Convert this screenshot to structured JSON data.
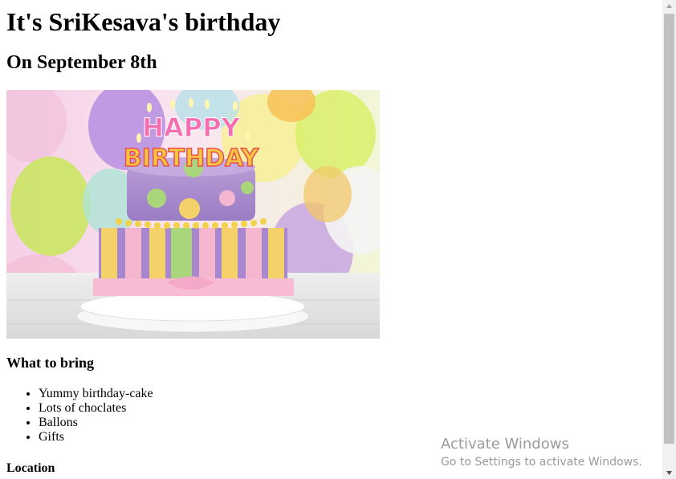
{
  "page": {
    "title": "It's SriKesava's birthday",
    "date_heading": "On September 8th",
    "cake_image": {
      "cake_text_top": "HAPPY",
      "cake_text_bottom": "BIRTHDAY"
    },
    "bring_heading": "What to bring",
    "bring_items": [
      "Yummy birthday-cake",
      "Lots of choclates",
      "Ballons",
      "Gifts"
    ],
    "location_heading": "Location"
  },
  "watermark": {
    "title": "Activate Windows",
    "subtitle": "Go to Settings to activate Windows."
  },
  "colors": {
    "scrollbar_track": "#f1f1f1",
    "scrollbar_thumb": "#c1c1c1",
    "watermark_text": "#9a9a9a"
  },
  "icons": {
    "scroll_up": "triangle-up-icon",
    "scroll_down": "triangle-down-icon"
  }
}
